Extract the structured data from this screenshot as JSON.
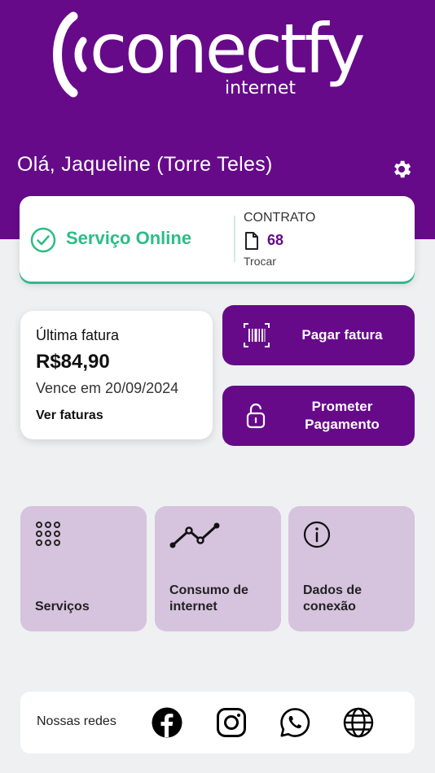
{
  "header": {
    "logo_word": "conectfy",
    "logo_sub": "internet",
    "greeting": "Olá, Jaqueline (Torre Teles)",
    "brand_color": "#660a8a"
  },
  "status": {
    "text": "Serviço Online",
    "color": "#2bbd86",
    "icon": "check-circle-icon"
  },
  "contract": {
    "label": "CONTRATO",
    "number": "68",
    "swap": "Trocar"
  },
  "invoice": {
    "title": "Última fatura",
    "amount": "R$84,90",
    "due": "Vence em 20/09/2024",
    "link": "Ver faturas"
  },
  "actions": {
    "pay": "Pagar fatura",
    "promise": "Prometer Pagamento"
  },
  "tiles": [
    {
      "label": "Serviços",
      "icon": "grid-icon"
    },
    {
      "label": "Consumo de internet",
      "icon": "chart-line-icon"
    },
    {
      "label": "Dados de conexão",
      "icon": "info-icon"
    }
  ],
  "social": {
    "label": "Nossas redes",
    "icons": [
      "facebook-icon",
      "instagram-icon",
      "whatsapp-icon",
      "globe-icon"
    ]
  }
}
